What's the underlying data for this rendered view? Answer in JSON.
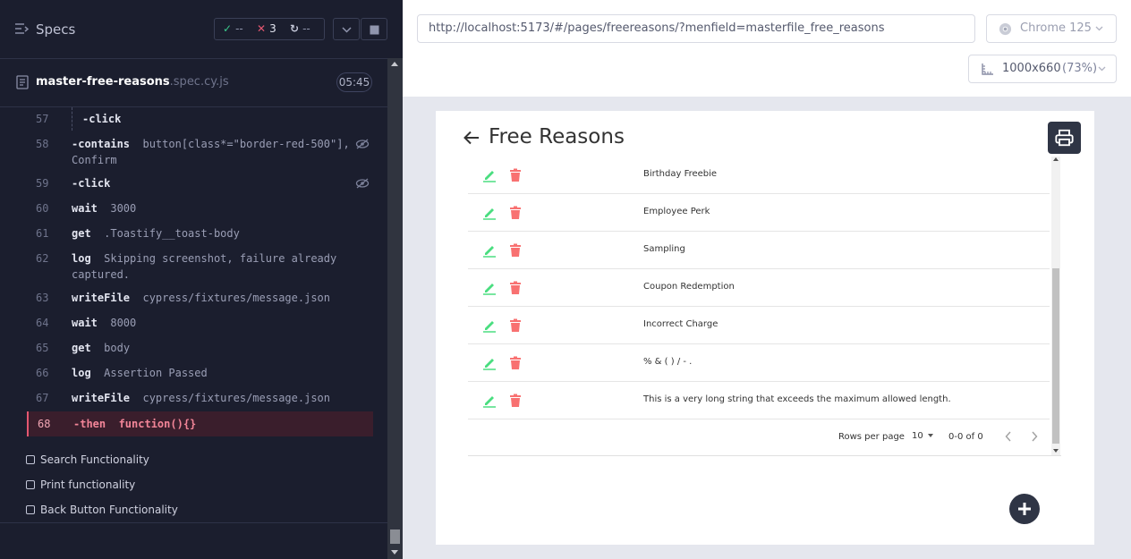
{
  "reporter": {
    "title": "Specs",
    "stats": {
      "passed": "--",
      "failed": "3",
      "pending": "--"
    },
    "spec_file": {
      "name": "master-free-reasons",
      "ext": ".spec.cy.js",
      "duration": "05:45"
    },
    "commands": [
      {
        "num": "57",
        "name": "-click",
        "msg": "",
        "nested": true,
        "eye": false
      },
      {
        "num": "58",
        "name": "-contains",
        "msg": "button[class*=\"border-red-500\"],\nConfirm",
        "nested": false,
        "eye": true
      },
      {
        "num": "59",
        "name": "-click",
        "msg": "",
        "nested": false,
        "eye": true
      },
      {
        "num": "60",
        "name": "wait",
        "msg": "3000",
        "nested": false,
        "eye": false
      },
      {
        "num": "61",
        "name": "get",
        "msg": ".Toastify__toast-body",
        "nested": false,
        "eye": false
      },
      {
        "num": "62",
        "name": "log",
        "msg": "Skipping screenshot, failure already\ncaptured.",
        "nested": false,
        "eye": false
      },
      {
        "num": "63",
        "name": "writeFile",
        "msg": "cypress/fixtures/message.json",
        "nested": false,
        "eye": false
      },
      {
        "num": "64",
        "name": "wait",
        "msg": "8000",
        "nested": false,
        "eye": false
      },
      {
        "num": "65",
        "name": "get",
        "msg": "body",
        "nested": false,
        "eye": false
      },
      {
        "num": "66",
        "name": "log",
        "msg": "Assertion Passed",
        "nested": false,
        "eye": false
      },
      {
        "num": "67",
        "name": "writeFile",
        "msg": "cypress/fixtures/message.json",
        "nested": false,
        "eye": false
      },
      {
        "num": "68",
        "name": "-then",
        "msg": "function(){}",
        "nested": false,
        "eye": false,
        "failed": true
      }
    ],
    "tests": [
      "Search Functionality",
      "Print functionality",
      "Back Button Functionality"
    ]
  },
  "browser": {
    "url": "http://localhost:5173/#/pages/freereasons/?menfield=masterfile_free_reasons",
    "name": "Chrome 125",
    "viewport": "1000x660",
    "zoom": "(73%)"
  },
  "app": {
    "title": "Free Reasons",
    "rows": [
      "Birthday Freebie",
      "Employee Perk",
      "Sampling",
      "Coupon Redemption",
      "Incorrect Charge",
      "% & ( ) / - .",
      "This is a very long string that exceeds the maximum allowed length."
    ],
    "footer": {
      "rows_per_page_label": "Rows per page",
      "rows_per_page": "10",
      "range": "0-0 of 0"
    }
  },
  "colors": {
    "accent_green": "#4ade80",
    "delete_red": "#f87171",
    "fail_red": "#e45770",
    "dark_button": "#2f3545"
  }
}
